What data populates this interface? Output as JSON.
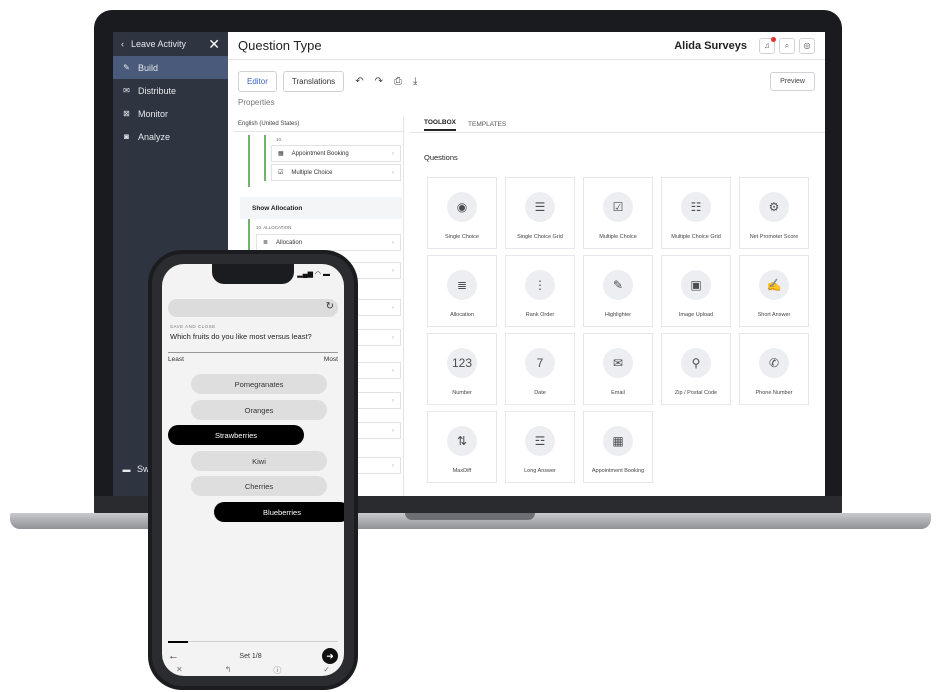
{
  "sidebar": {
    "back_label": "Leave Activity",
    "items": [
      {
        "label": "Build",
        "icon": "pencil-icon",
        "active": true
      },
      {
        "label": "Distribute",
        "icon": "mail-icon"
      },
      {
        "label": "Monitor",
        "icon": "chart-icon"
      },
      {
        "label": "Analyze",
        "icon": "analyze-icon"
      }
    ],
    "bottom_label": "Swi"
  },
  "header": {
    "title": "Question Type",
    "brand": "Alida Surveys"
  },
  "tabs": {
    "editor": "Editor",
    "translations": "Translations",
    "preview": "Preview"
  },
  "properties_label": "Properties",
  "left_pane": {
    "language": "English (United States)",
    "num_label": "10.",
    "rows": [
      "Appointment Booking",
      "Multiple Choice",
      "Allocation"
    ],
    "group": "Show Allocation",
    "alloc_label": "10. ALLOCATION"
  },
  "toolbox": {
    "tabs": [
      "TOOLBOX",
      "TEMPLATES"
    ],
    "section": "Questions",
    "cards": [
      {
        "label": "Single Choice",
        "glyph": "◉"
      },
      {
        "label": "Single Choice Grid",
        "glyph": "☰"
      },
      {
        "label": "Multiple Choice",
        "glyph": "☑"
      },
      {
        "label": "Multiple Choice Grid",
        "glyph": "☷"
      },
      {
        "label": "Net Promoter Score",
        "glyph": "⚙"
      },
      {
        "label": "Allocation",
        "glyph": "≣"
      },
      {
        "label": "Rank Order",
        "glyph": "⋮"
      },
      {
        "label": "Highlighter",
        "glyph": "✎"
      },
      {
        "label": "Image Upload",
        "glyph": "▣"
      },
      {
        "label": "Short Answer",
        "glyph": "✍"
      },
      {
        "label": "Number",
        "glyph": "123"
      },
      {
        "label": "Date",
        "glyph": "7"
      },
      {
        "label": "Email",
        "glyph": "✉"
      },
      {
        "label": "Zip / Postal Code",
        "glyph": "⚲"
      },
      {
        "label": "Phone Number",
        "glyph": "✆"
      },
      {
        "label": "MaxDiff",
        "glyph": "⇅"
      },
      {
        "label": "Long Answer",
        "glyph": "☲"
      },
      {
        "label": "Appointment Booking",
        "glyph": "▦"
      }
    ]
  },
  "phone": {
    "save_close": "SAVE AND CLOSE",
    "question": "Which fruits do you like most versus least?",
    "least": "Least",
    "most": "Most",
    "options": [
      "Pomegranates",
      "Oranges",
      "Strawberries",
      "Kiwi",
      "Cherries",
      "Blueberries"
    ],
    "set_label": "Set 1/8",
    "progress": 0.12
  }
}
